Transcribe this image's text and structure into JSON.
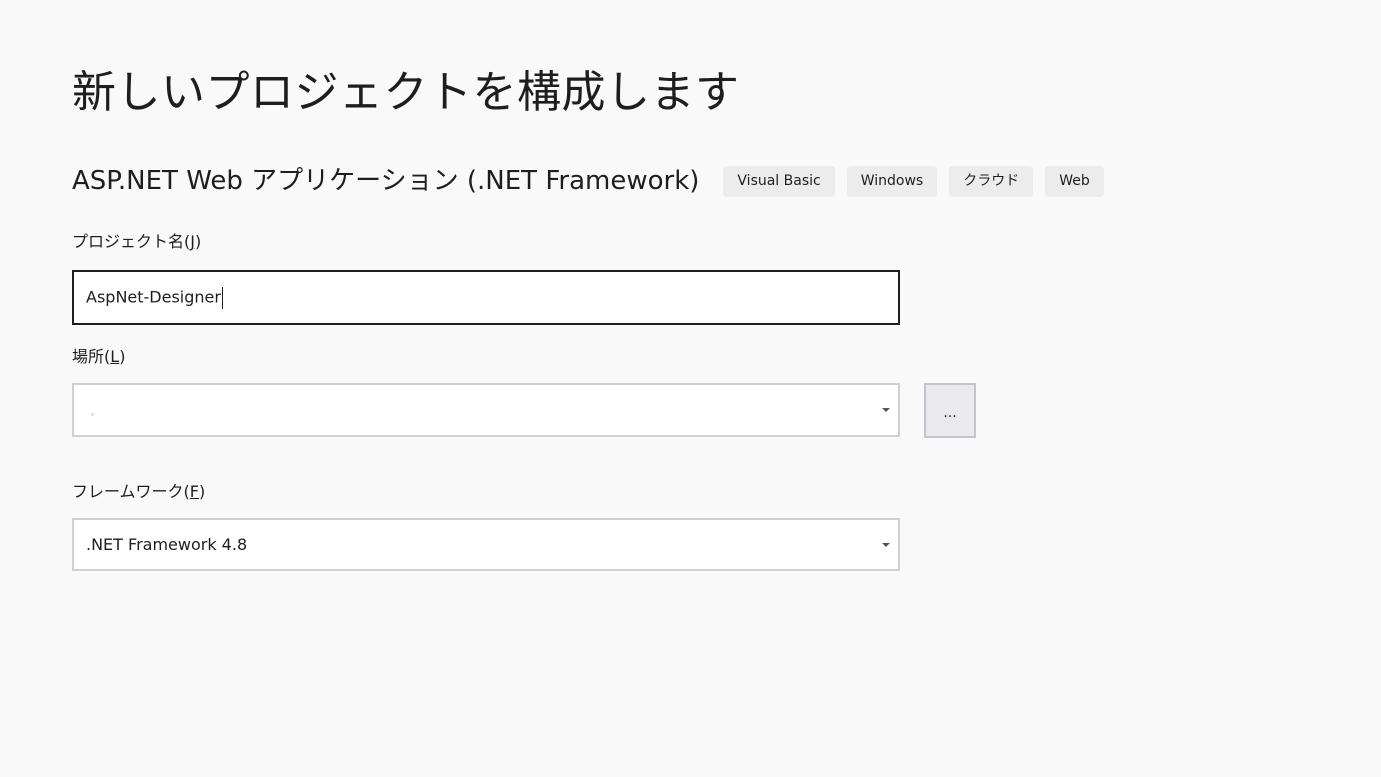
{
  "page": {
    "title": "新しいプロジェクトを構成します",
    "template_name": "ASP.NET Web アプリケーション (.NET Framework)",
    "tags": [
      "Visual Basic",
      "Windows",
      "クラウド",
      "Web"
    ]
  },
  "project_name": {
    "label": "プロジェクト名",
    "accel_open": "(",
    "accel": "J",
    "accel_close": ")",
    "value": "AspNet-Designer"
  },
  "location": {
    "label": "場所",
    "accel_open": "(",
    "accel": "L",
    "accel_close": ")",
    "value": "",
    "browse_label": "..."
  },
  "framework": {
    "label": "フレームワーク",
    "accel_open": "(",
    "accel": "F",
    "accel_close": ")",
    "value": ".NET Framework 4.8"
  },
  "icons": {
    "dropdown": "chevron-down-icon"
  },
  "colors": {
    "background": "#f9f9f9",
    "tag_background": "#ececec",
    "input_border_focused": "#1e1e1e",
    "input_border": "#cfcfd8"
  }
}
